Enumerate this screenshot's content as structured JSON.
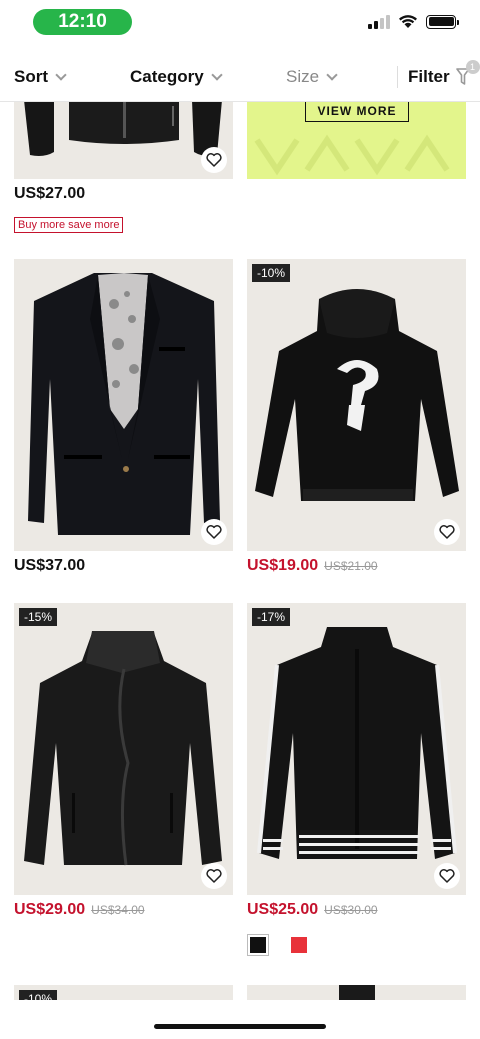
{
  "status_bar": {
    "time": "12:10"
  },
  "filter_bar": {
    "sort_label": "Sort",
    "category_label": "Category",
    "size_label": "Size",
    "filter_label": "Filter",
    "filter_count": "1"
  },
  "banner": {
    "button_label": "VIEW MORE",
    "color": "#e3f58c"
  },
  "products": [
    {
      "price": "US$27.00",
      "promo": "Buy more save more"
    },
    {
      "price": "US$37.00"
    },
    {
      "discount": "-10%",
      "price": "US$19.00",
      "original_price": "US$21.00"
    },
    {
      "discount": "-15%",
      "price": "US$29.00",
      "original_price": "US$34.00"
    },
    {
      "discount": "-17%",
      "price": "US$25.00",
      "original_price": "US$30.00",
      "swatches": [
        "#111111",
        "#e8323a"
      ]
    },
    {
      "discount": "-10%"
    }
  ],
  "colors": {
    "sale_price": "#c4122d",
    "accent_green": "#27b54a"
  }
}
